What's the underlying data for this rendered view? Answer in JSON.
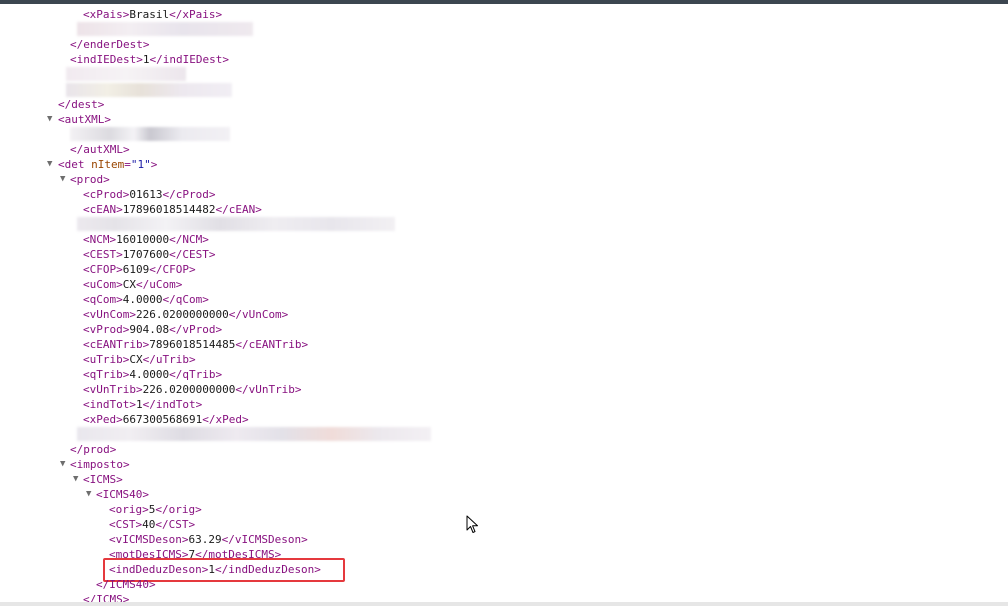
{
  "xml": {
    "xPais": {
      "open": "<xPais>",
      "value": "Brasil",
      "close": "</xPais>"
    },
    "enderDest_close": "</enderDest>",
    "indIEDest": {
      "open": "<indIEDest>",
      "value": "1",
      "close": "</indIEDest>"
    },
    "dest_close": "</dest>",
    "autXML_open": "<autXML>",
    "autXML_close": "</autXML>",
    "det_open": {
      "tag": "<det",
      "attr": "nItem",
      "eq": "=",
      "val": "\"1\"",
      "end": ">"
    },
    "prod_open": "<prod>",
    "prod_fields": [
      {
        "open": "<cProd>",
        "value": "01613",
        "close": "</cProd>"
      },
      {
        "open": "<cEAN>",
        "value": "17896018514482",
        "close": "</cEAN>"
      },
      {
        "open": "<NCM>",
        "value": "16010000",
        "close": "</NCM>"
      },
      {
        "open": "<CEST>",
        "value": "1707600",
        "close": "</CEST>"
      },
      {
        "open": "<CFOP>",
        "value": "6109",
        "close": "</CFOP>"
      },
      {
        "open": "<uCom>",
        "value": "CX",
        "close": "</uCom>"
      },
      {
        "open": "<qCom>",
        "value": "4.0000",
        "close": "</qCom>"
      },
      {
        "open": "<vUnCom>",
        "value": "226.0200000000",
        "close": "</vUnCom>"
      },
      {
        "open": "<vProd>",
        "value": "904.08",
        "close": "</vProd>"
      },
      {
        "open": "<cEANTrib>",
        "value": "7896018514485",
        "close": "</cEANTrib>"
      },
      {
        "open": "<uTrib>",
        "value": "CX",
        "close": "</uTrib>"
      },
      {
        "open": "<qTrib>",
        "value": "4.0000",
        "close": "</qTrib>"
      },
      {
        "open": "<vUnTrib>",
        "value": "226.0200000000",
        "close": "</vUnTrib>"
      },
      {
        "open": "<indTot>",
        "value": "1",
        "close": "</indTot>"
      },
      {
        "open": "<xPed>",
        "value": "6673005686​91",
        "close": "</xPed>"
      }
    ],
    "prod_close": "</prod>",
    "imposto_open": "<imposto>",
    "icms_open": "<ICMS>",
    "icms40_open": "<ICMS40>",
    "icms40_fields": [
      {
        "open": "<orig>",
        "value": "5",
        "close": "</orig>"
      },
      {
        "open": "<CST>",
        "value": "40",
        "close": "</CST>"
      },
      {
        "open": "<vICMSDeson>",
        "value": "63.29",
        "close": "</vICMSDeson>"
      },
      {
        "open": "<motDesICMS>",
        "value": "7",
        "close": "</motDesICMS>"
      },
      {
        "open": "<indDeduzDeson>",
        "value": "1",
        "close": "</indDeduzDeson>"
      }
    ],
    "icms40_close": "</ICMS40>",
    "icms_close": "</ICMS>"
  },
  "icons": {
    "toggle": "▼",
    "cursor": "mouse-pointer-icon"
  },
  "colors": {
    "highlight": "#e5393d",
    "tag": "#881280",
    "attr_name": "#994500",
    "attr_val": "#1a1aa6"
  }
}
